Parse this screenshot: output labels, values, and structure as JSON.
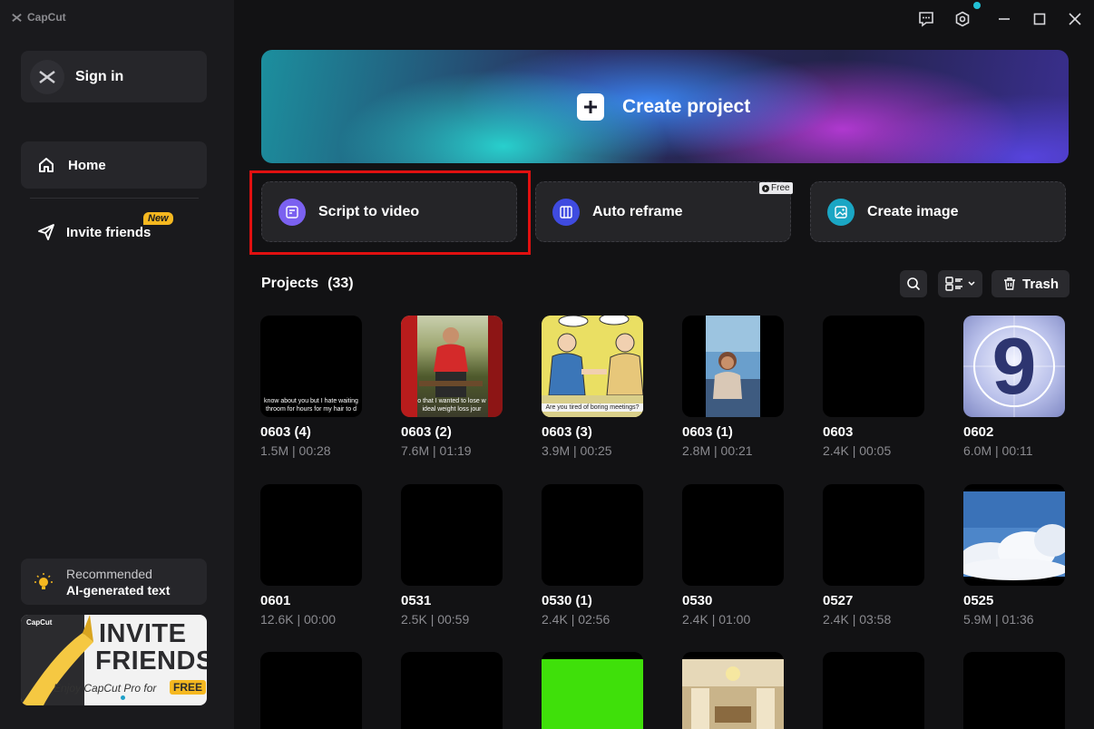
{
  "app": {
    "name": "CapCut"
  },
  "sidebar": {
    "sign_in": "Sign in",
    "nav": {
      "home": "Home",
      "invite": "Invite friends",
      "new_badge": "New"
    },
    "recommended": {
      "line1": "Recommended",
      "line2": "AI-generated text"
    },
    "banner": {
      "brand": "CapCut",
      "title1": "INVITE",
      "title2": "FRIENDS",
      "subtitle": "Enjoy CapCut Pro for",
      "free": "FREE"
    }
  },
  "main": {
    "create_project": "Create project",
    "tools": [
      {
        "label": "Script to video"
      },
      {
        "label": "Auto reframe",
        "badge": "Free"
      },
      {
        "label": "Create image"
      }
    ],
    "projects": {
      "title": "Projects",
      "count": "(33)",
      "trash": "Trash"
    },
    "cards": [
      {
        "name": "0603 (4)",
        "meta": "1.5M | 00:28",
        "caption1": "know about you but I hate waiting",
        "caption2": "throom for hours for my hair to d"
      },
      {
        "name": "0603 (2)",
        "meta": "7.6M | 01:19",
        "caption1": "o that I wanted to lose w",
        "caption2": "ideal weight loss jour"
      },
      {
        "name": "0603 (3)",
        "meta": "3.9M | 00:25",
        "caption1": "Are you tired of boring meetings?"
      },
      {
        "name": "0603 (1)",
        "meta": "2.8M | 00:21"
      },
      {
        "name": "0603",
        "meta": "2.4K | 00:05"
      },
      {
        "name": "0602",
        "meta": "6.0M | 00:11",
        "digit": "9"
      },
      {
        "name": "0601",
        "meta": "12.6K | 00:00"
      },
      {
        "name": "0531",
        "meta": "2.5K | 00:59"
      },
      {
        "name": "0530 (1)",
        "meta": "2.4K | 02:56"
      },
      {
        "name": "0530",
        "meta": "2.4K | 01:00"
      },
      {
        "name": "0527",
        "meta": "2.4K | 03:58"
      },
      {
        "name": "0525",
        "meta": "5.9M | 01:36"
      }
    ]
  },
  "colors": {
    "accent_teal": "#22c1d6",
    "highlight_red": "#e01010",
    "badge_yellow": "#f5b820"
  }
}
